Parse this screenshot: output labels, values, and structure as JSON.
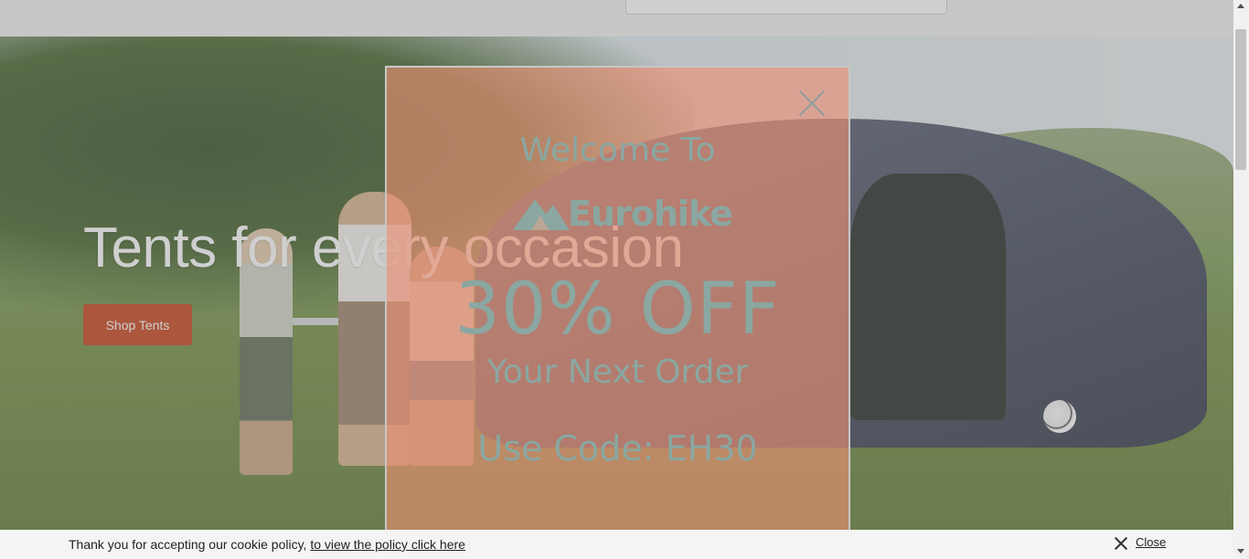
{
  "hero": {
    "title": "Tents for every occasion",
    "cta_label": "Shop Tents"
  },
  "popup": {
    "welcome": "Welcome To",
    "brand": "Eurohike",
    "discount": "30% OFF",
    "subline": "Your Next Order",
    "code_line": "Use Code: EH30"
  },
  "cookie_bar": {
    "message": "Thank you for accepting our cookie policy, ",
    "link_text": "to view the policy click here",
    "close_label": "Close"
  },
  "colors": {
    "cta": "#c63d14",
    "popup_bg": "#ec8f73",
    "popup_text": "#8aa7a1"
  }
}
